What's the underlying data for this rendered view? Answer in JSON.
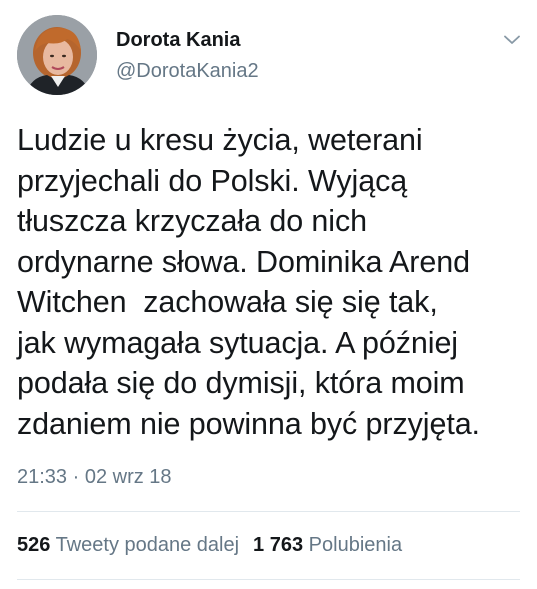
{
  "author": {
    "name": "Dorota Kania",
    "handle": "@DorotaKania2"
  },
  "tweet": {
    "lines": [
      "Ludzie u kresu życia, weterani",
      "przyjechali do Polski. Wyjącą",
      "tłuszcza krzyczała do nich",
      "ordynarne słowa. Dominika Arend",
      "Witchen  zachowała się się tak,",
      "jak wymagała sytuacja. A później",
      "podała się do dymisji, która moim",
      "zdaniem nie powinna być przyjęta."
    ],
    "timestamp": "21:33 · 02 wrz 18"
  },
  "stats": {
    "retweets_count": "526",
    "retweets_label": "Tweety podane dalej",
    "likes_count": "1 763",
    "likes_label": "Polubienia"
  },
  "icons": {
    "menu": "chevron-down-icon"
  },
  "colors": {
    "text": "#14171a",
    "secondary": "#657786",
    "divider": "#e1e8ed"
  }
}
